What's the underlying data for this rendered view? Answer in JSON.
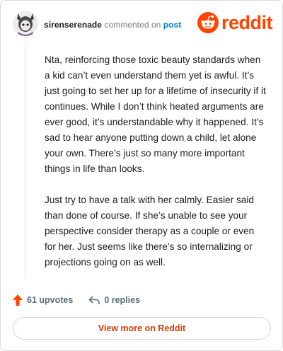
{
  "header": {
    "username": "sirenserenade",
    "action_text": "commented on",
    "post_link": "post",
    "logo_text": "reddit"
  },
  "comment": {
    "paragraphs": [
      "Nta, reinforcing those toxic beauty standards when a kid can’t even understand them yet is awful. It’s just going to set her up for a lifetime of insecurity if it continues. While I don’t think heated arguments are ever good, it’s understandable why it happened. It’s sad to hear anyone putting down a child, let alone your own. There’s just so many more important things in life than looks.",
      "Just try to have a talk with her calmly. Easier said than done of course. If she’s unable to see your perspective consider therapy as a couple or even for her. Just seems like there’s so internalizing or projections going on as well."
    ]
  },
  "actions": {
    "upvotes": "61 upvotes",
    "replies": "0 replies"
  },
  "footer": {
    "view_more": "View more on Reddit"
  },
  "colors": {
    "brand": "#ff4500",
    "link": "#0079d3",
    "view_more_text": "#d93a00"
  },
  "icons": [
    "avatar-image",
    "reddit-snoo-icon",
    "upvote-arrow-icon",
    "reply-icon"
  ]
}
